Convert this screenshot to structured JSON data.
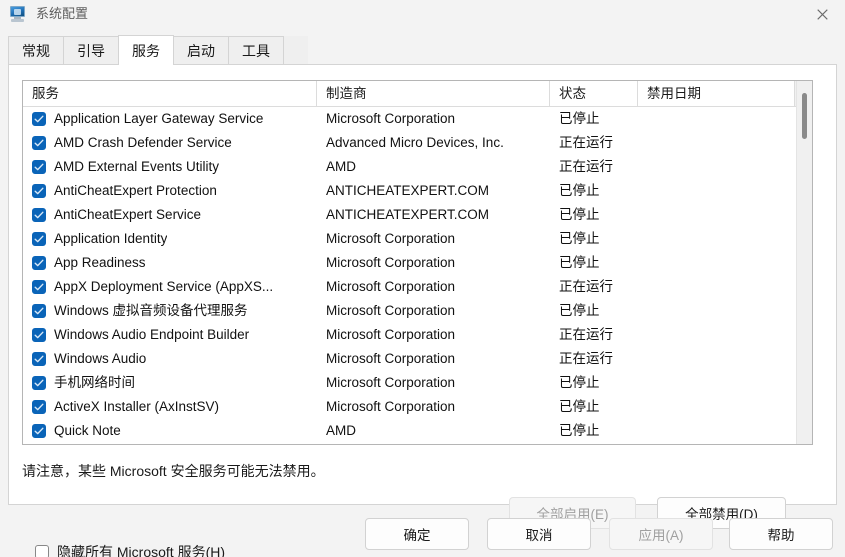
{
  "window": {
    "title": "系统配置",
    "icon": "computer-monitor-icon",
    "close_label": "×",
    "accent": "#0a64b8"
  },
  "tabs": [
    {
      "label": "常规",
      "active": false
    },
    {
      "label": "引导",
      "active": false
    },
    {
      "label": "服务",
      "active": true
    },
    {
      "label": "启动",
      "active": false
    },
    {
      "label": "工具",
      "active": false
    }
  ],
  "services_tab": {
    "columns": [
      "服务",
      "制造商",
      "状态",
      "禁用日期"
    ],
    "rows": [
      {
        "checked": true,
        "name": "Application Layer Gateway Service",
        "vendor": "Microsoft Corporation",
        "status": "已停止",
        "date": ""
      },
      {
        "checked": true,
        "name": "AMD Crash Defender Service",
        "vendor": "Advanced Micro Devices, Inc.",
        "status": "正在运行",
        "date": ""
      },
      {
        "checked": true,
        "name": "AMD External Events Utility",
        "vendor": "AMD",
        "status": "正在运行",
        "date": ""
      },
      {
        "checked": true,
        "name": "AntiCheatExpert Protection",
        "vendor": "ANTICHEATEXPERT.COM",
        "status": "已停止",
        "date": ""
      },
      {
        "checked": true,
        "name": "AntiCheatExpert Service",
        "vendor": "ANTICHEATEXPERT.COM",
        "status": "已停止",
        "date": ""
      },
      {
        "checked": true,
        "name": "Application Identity",
        "vendor": "Microsoft Corporation",
        "status": "已停止",
        "date": ""
      },
      {
        "checked": true,
        "name": "App Readiness",
        "vendor": "Microsoft Corporation",
        "status": "已停止",
        "date": ""
      },
      {
        "checked": true,
        "name": "AppX Deployment Service (AppXS...",
        "vendor": "Microsoft Corporation",
        "status": "正在运行",
        "date": ""
      },
      {
        "checked": true,
        "name": "Windows 虚拟音频设备代理服务",
        "vendor": "Microsoft Corporation",
        "status": "已停止",
        "date": ""
      },
      {
        "checked": true,
        "name": "Windows Audio Endpoint Builder",
        "vendor": "Microsoft Corporation",
        "status": "正在运行",
        "date": ""
      },
      {
        "checked": true,
        "name": "Windows Audio",
        "vendor": "Microsoft Corporation",
        "status": "正在运行",
        "date": ""
      },
      {
        "checked": true,
        "name": "手机网络时间",
        "vendor": "Microsoft Corporation",
        "status": "已停止",
        "date": ""
      },
      {
        "checked": true,
        "name": "ActiveX Installer (AxInstSV)",
        "vendor": "Microsoft Corporation",
        "status": "已停止",
        "date": ""
      },
      {
        "checked": true,
        "name": "Quick Note",
        "vendor": "AMD",
        "status": "已停止",
        "date": ""
      }
    ],
    "note": "请注意，某些 Microsoft 安全服务可能无法禁用。",
    "enable_all_label": "全部启用(E)",
    "enable_all_disabled": true,
    "disable_all_label": "全部禁用(D)",
    "disable_all_disabled": false,
    "hide_microsoft_label": "隐藏所有 Microsoft 服务(H)",
    "hide_microsoft_checked": false
  },
  "footer": {
    "ok_label": "确定",
    "cancel_label": "取消",
    "apply_label": "应用(A)",
    "apply_disabled": true,
    "help_label": "帮助"
  }
}
